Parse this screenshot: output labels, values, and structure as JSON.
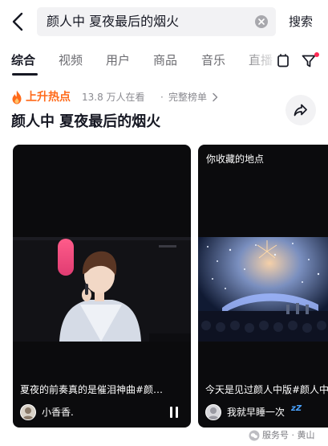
{
  "search": {
    "query": "颜人中 夏夜最后的烟火",
    "submit_label": "搜索"
  },
  "tabs": [
    {
      "label": "综合",
      "active": true
    },
    {
      "label": "视频",
      "active": false
    },
    {
      "label": "用户",
      "active": false
    },
    {
      "label": "商品",
      "active": false
    },
    {
      "label": "音乐",
      "active": false
    },
    {
      "label": "直播",
      "active": false
    }
  ],
  "hot": {
    "label": "上升热点",
    "viewers": "13.8 万人在看",
    "separator": "·",
    "full_list": "完整榜单"
  },
  "topic_title": "颜人中 夏夜最后的烟火",
  "cards": [
    {
      "caption": "夏夜的前奏真的是催泪神曲#颜…",
      "author": "小香香.",
      "playing": true
    },
    {
      "top_label": "你收藏的地点",
      "caption": "今天是见过颜人中版#颜人中",
      "author": "我就早睡一次",
      "author_suffix": "zZ"
    }
  ],
  "watermark": "服务号 · 黄山",
  "colors": {
    "accent": "#fe2c55",
    "hot_orange": "#ff6a1a",
    "text_primary": "#161823",
    "text_secondary": "#8a8a90",
    "search_bg": "#f2f2f4"
  },
  "icons": {
    "back": "chevron-left-icon",
    "clear": "clear-circle-icon",
    "layout": "layout-toggle-icon",
    "filter": "filter-funnel-icon",
    "hot": "fire-icon",
    "more": "chevron-right-icon",
    "share": "share-arrow-icon",
    "pause": "pause-icon"
  }
}
